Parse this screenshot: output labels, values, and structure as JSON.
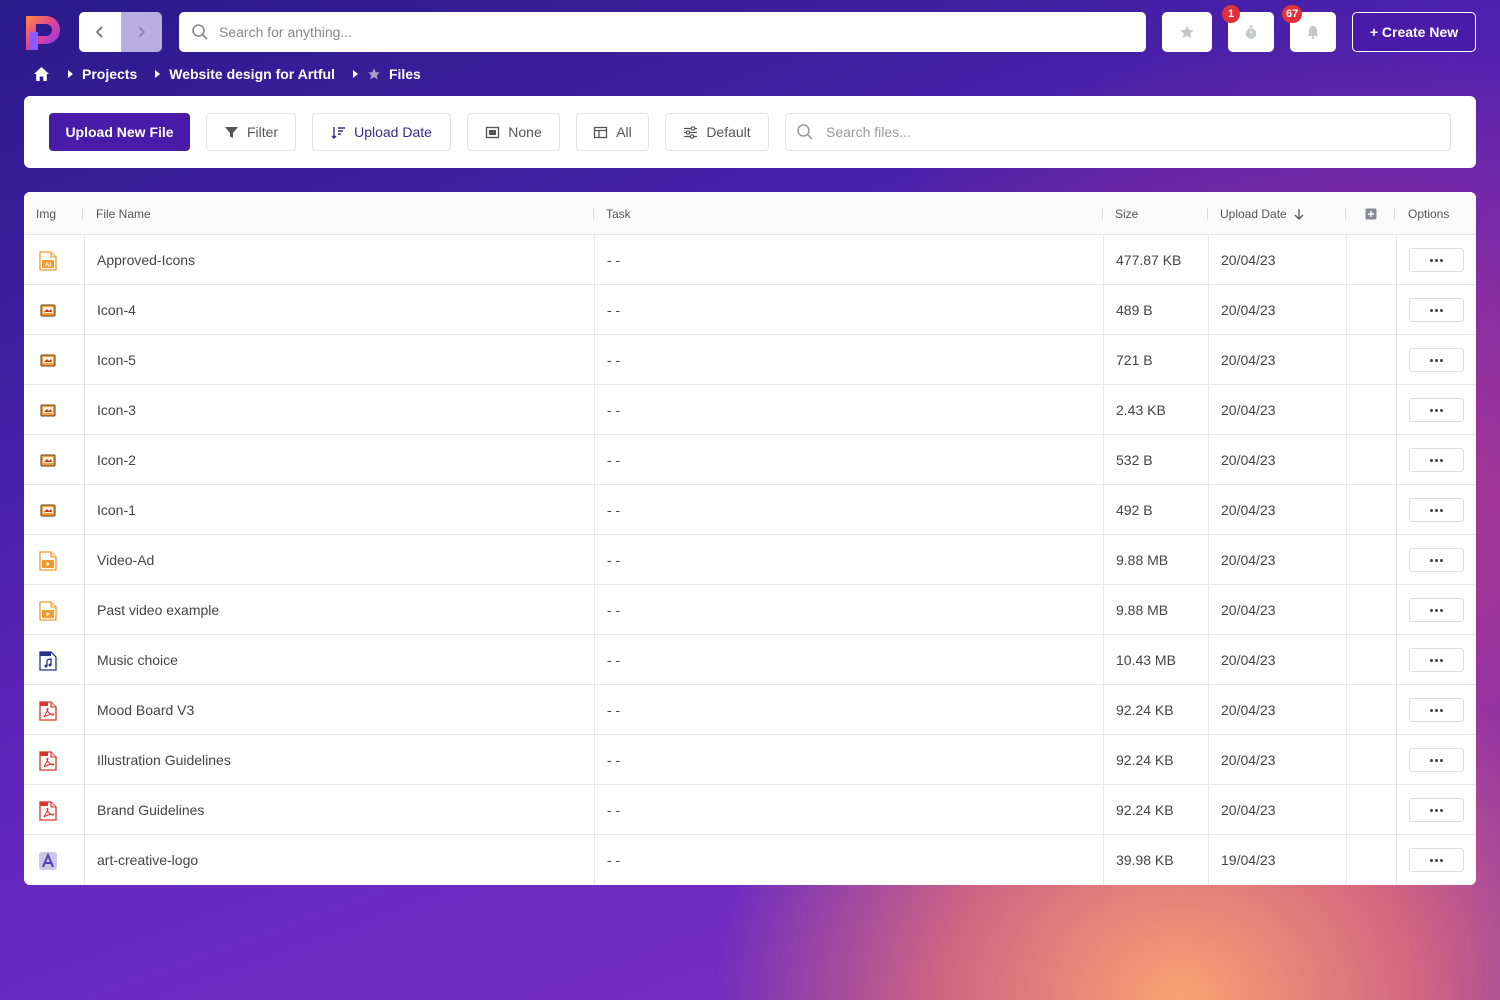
{
  "header": {
    "search_placeholder": "Search for anything...",
    "badges": {
      "timer": "1",
      "notifications": "67"
    },
    "create_label": "+ Create New"
  },
  "breadcrumb": {
    "items": [
      "Projects",
      "Website design for Artful",
      "Files"
    ]
  },
  "toolbar": {
    "upload_label": "Upload New File",
    "filter_label": "Filter",
    "sort_label": "Upload Date",
    "group_label": "None",
    "columns_label": "All",
    "view_label": "Default",
    "search_placeholder": "Search files..."
  },
  "table": {
    "headers": {
      "img": "Img",
      "file_name": "File Name",
      "task": "Task",
      "size": "Size",
      "upload_date": "Upload Date",
      "options": "Options"
    },
    "rows": [
      {
        "icon": "ai-file-icon",
        "name": "Approved-Icons",
        "task": "- -",
        "size": "477.87 KB",
        "date": "20/04/23"
      },
      {
        "icon": "image-thumbnail-icon",
        "name": "Icon-4",
        "task": "- -",
        "size": "489 B",
        "date": "20/04/23"
      },
      {
        "icon": "image-thumbnail-icon",
        "name": "Icon-5",
        "task": "- -",
        "size": "721 B",
        "date": "20/04/23"
      },
      {
        "icon": "image-thumbnail-icon",
        "name": "Icon-3",
        "task": "- -",
        "size": "2.43 KB",
        "date": "20/04/23"
      },
      {
        "icon": "image-thumbnail-icon",
        "name": "Icon-2",
        "task": "- -",
        "size": "532 B",
        "date": "20/04/23"
      },
      {
        "icon": "image-thumbnail-icon",
        "name": "Icon-1",
        "task": "- -",
        "size": "492 B",
        "date": "20/04/23"
      },
      {
        "icon": "video-file-icon",
        "name": "Video-Ad",
        "task": "- -",
        "size": "9.88 MB",
        "date": "20/04/23"
      },
      {
        "icon": "video-file-icon",
        "name": "Past video example",
        "task": "- -",
        "size": "9.88 MB",
        "date": "20/04/23"
      },
      {
        "icon": "audio-file-icon",
        "name": "Music choice",
        "task": "- -",
        "size": "10.43 MB",
        "date": "20/04/23"
      },
      {
        "icon": "pdf-file-icon",
        "name": "Mood Board V3",
        "task": "- -",
        "size": "92.24 KB",
        "date": "20/04/23"
      },
      {
        "icon": "pdf-file-icon",
        "name": "Illustration Guidelines",
        "task": "- -",
        "size": "92.24 KB",
        "date": "20/04/23"
      },
      {
        "icon": "pdf-file-icon",
        "name": "Brand Guidelines",
        "task": "- -",
        "size": "92.24 KB",
        "date": "20/04/23"
      },
      {
        "icon": "logo-thumbnail-icon",
        "name": "art-creative-logo",
        "task": "- -",
        "size": "39.98 KB",
        "date": "19/04/23"
      }
    ]
  },
  "colors": {
    "brand": "#4a1aa8",
    "badge": "#e0303a",
    "ai_orange": "#f29a2e",
    "pdf_red": "#d9342b",
    "audio_navy": "#2a2f8a"
  }
}
